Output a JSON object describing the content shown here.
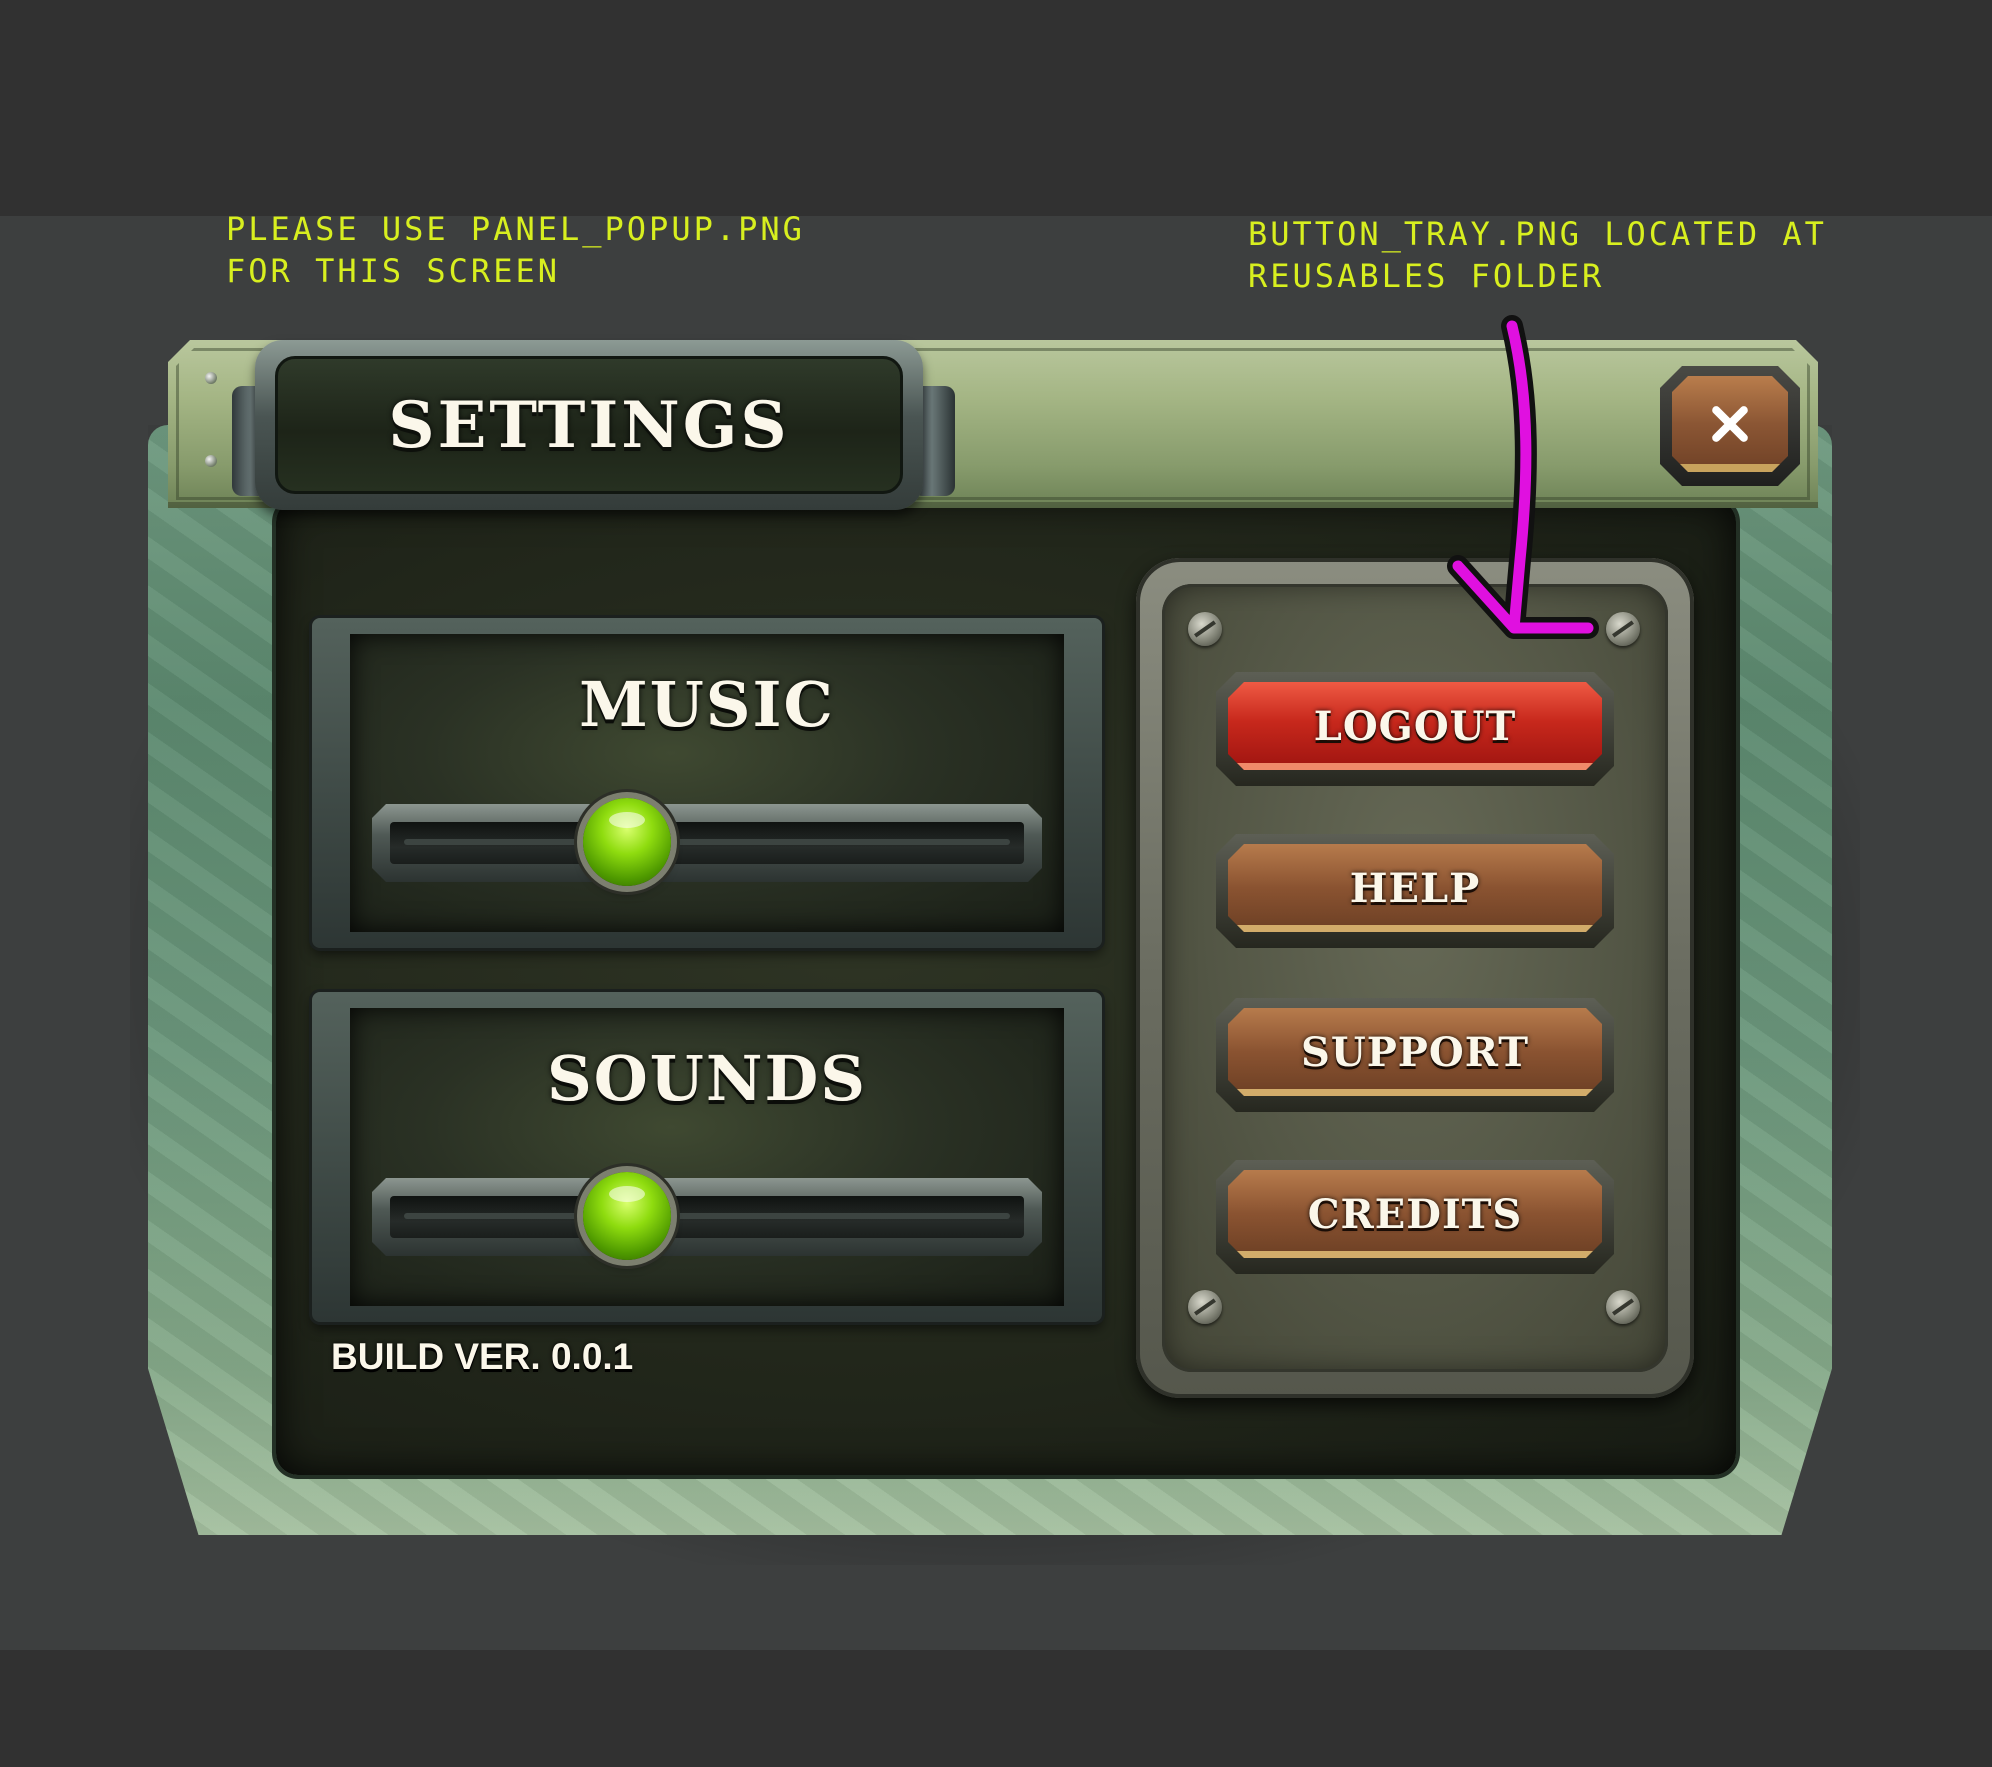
{
  "annotations": {
    "left_note": "PLEASE USE PANEL_POPUP.PNG\nFOR THIS SCREEN",
    "right_note": "BUTTON_TRAY.PNG LOCATED AT\nREUSABLES FOLDER",
    "note_color": "#d8ef1f",
    "arrow_color": "#e010e0"
  },
  "header": {
    "title": "SETTINGS",
    "close_icon": "close-icon"
  },
  "audio": {
    "music": {
      "label": "MUSIC",
      "level": 0.38
    },
    "sounds": {
      "label": "SOUNDS",
      "level": 0.38
    }
  },
  "tray": {
    "buttons": [
      {
        "label": "LOGOUT",
        "style": "red",
        "color": "#c7281c"
      },
      {
        "label": "HELP",
        "style": "brown",
        "color": "#8a5331"
      },
      {
        "label": "SUPPORT",
        "style": "brown",
        "color": "#8a5331"
      },
      {
        "label": "CREDITS",
        "style": "brown",
        "color": "#8a5331"
      }
    ]
  },
  "footer": {
    "build": "BUILD VER. 0.0.1"
  }
}
